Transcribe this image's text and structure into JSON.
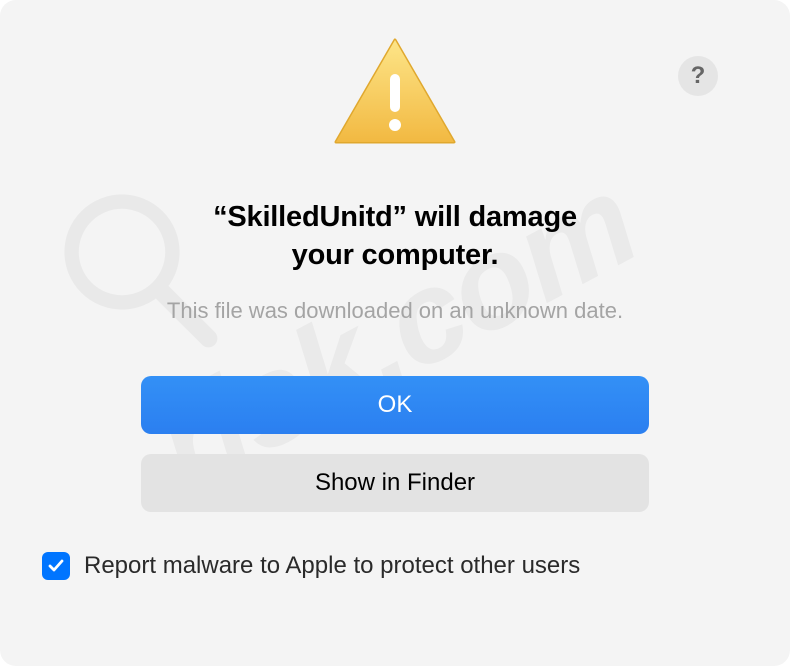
{
  "help_tooltip": "?",
  "title_line1": "“SkilledUnitd” will damage",
  "title_line2": "your computer.",
  "subtitle": "This file was downloaded on an unknown date.",
  "buttons": {
    "primary": "OK",
    "secondary": "Show in Finder"
  },
  "checkbox": {
    "checked": true,
    "label": "Report malware to Apple to protect other users"
  },
  "watermark": "risk.com",
  "colors": {
    "primary_button": "#2b7ff0",
    "secondary_button": "#e3e3e3",
    "checkbox": "#0075ff",
    "bg": "#f4f4f4"
  }
}
